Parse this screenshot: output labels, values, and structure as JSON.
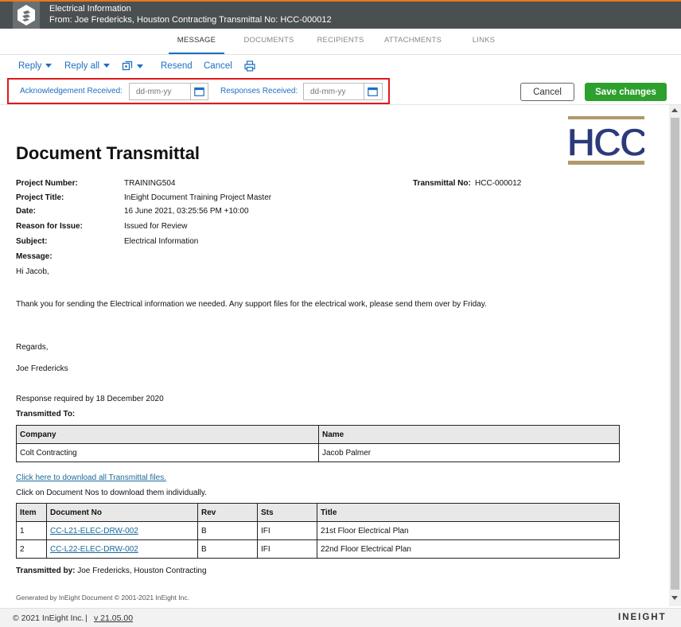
{
  "header": {
    "title": "Electrical Information",
    "subtitle": "From: Joe Fredericks, Houston Contracting Transmittal No: HCC-000012"
  },
  "tabs": [
    {
      "label": "MESSAGE",
      "active": true
    },
    {
      "label": "DOCUMENTS"
    },
    {
      "label": "RECIPIENTS"
    },
    {
      "label": "ATTACHMENTS"
    },
    {
      "label": "LINKS"
    }
  ],
  "toolbar": {
    "reply": "Reply",
    "reply_all": "Reply all",
    "resend": "Resend",
    "cancel": "Cancel",
    "icons": [
      "copy-icon",
      "print-icon"
    ]
  },
  "ack": {
    "ack_label": "Acknowledgement Received:",
    "ack_placeholder": "dd-mm-yy",
    "resp_label": "Responses Received:",
    "resp_placeholder": "dd-mm-yy",
    "cancel_label": "Cancel",
    "save_label": "Save changes"
  },
  "doc": {
    "title": "Document Transmittal",
    "logo_text": "HCC",
    "fields": {
      "project_number_label": "Project Number:",
      "project_number": "TRAINING504",
      "transmittal_no_label": "Transmittal No:",
      "transmittal_no": "HCC-000012",
      "project_title_label": "Project Title:",
      "project_title": "InEight Document Training Project Master",
      "date_label": "Date:",
      "date": "16 June 2021, 03:25:56 PM +10:00",
      "reason_label": "Reason for Issue:",
      "reason": "Issued for Review",
      "subject_label": "Subject:",
      "subject": "Electrical Information",
      "message_label": "Message:"
    },
    "message": {
      "greeting": "Hi Jacob,",
      "body": "Thank you for sending the Electrical information we needed. Any support files for the electrical work, please send them over by Friday.",
      "regards": "Regards,",
      "signature": "Joe Fredericks"
    },
    "response_required": "Response required by 18 December 2020",
    "transmitted_to_label": "Transmitted To:",
    "recipients_headers": [
      "Company",
      "Name"
    ],
    "recipients": [
      {
        "company": "Colt Contracting",
        "name": "Jacob Palmer"
      }
    ],
    "download_all": "Click here to download all Transmittal files.",
    "download_hint": "Click on Document Nos to download them individually.",
    "docs_headers": [
      "Item",
      "Document No",
      "Rev",
      "Sts",
      "Title"
    ],
    "documents": [
      {
        "item": "1",
        "doc_no": "CC-L21-ELEC-DRW-002",
        "rev": "B",
        "sts": "IFI",
        "title": "21st Floor Electrical Plan"
      },
      {
        "item": "2",
        "doc_no": "CC-L22-ELEC-DRW-002",
        "rev": "B",
        "sts": "IFI",
        "title": "22nd Floor Electrical Plan"
      }
    ],
    "transmitted_by_label": "Transmitted by:",
    "transmitted_by": "Joe Fredericks, Houston Contracting",
    "generated_by": "Generated by InEight Document © 2001-2021 InEight Inc."
  },
  "footer": {
    "copyright": "© 2021 InEight Inc.",
    "separator": "|",
    "version": "v 21.05.00",
    "brand": "INEIGHT"
  },
  "colors": {
    "accent": "#1e6fc2",
    "header_bg": "#4a4f52",
    "save_green": "#2da02d",
    "highlight_red": "#e0191b",
    "logo_navy": "#2b3a7a",
    "logo_gold": "#b09a6a"
  }
}
